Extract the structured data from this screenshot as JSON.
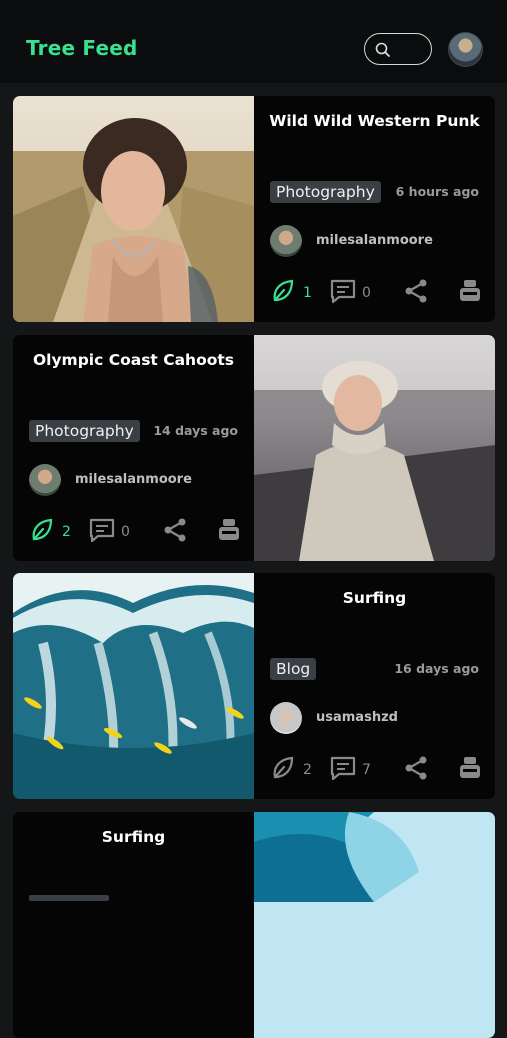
{
  "header": {
    "title": "Tree Feed",
    "search_icon": "search-icon",
    "avatar": "user-avatar"
  },
  "colors": {
    "accent": "#38e08f",
    "background": "#151618",
    "card": "#050506",
    "badge": "#3a3f46"
  },
  "posts": [
    {
      "title": "Wild Wild Western Punk",
      "category": "Photography",
      "time": "6 hours ago",
      "author": "milesalanmoore",
      "likes": "1",
      "comments": "0",
      "liked": true,
      "image": "portrait-woman-curly-hair"
    },
    {
      "title": "Olympic Coast Cahoots",
      "category": "Photography",
      "time": "14 days ago",
      "author": "milesalanmoore",
      "likes": "2",
      "comments": "0",
      "liked": true,
      "image": "woman-bucket-hat-beach"
    },
    {
      "title": "Surfing",
      "category": "Blog",
      "time": "16 days ago",
      "author": "usamashzd",
      "likes": "2",
      "comments": "7",
      "liked": false,
      "image": "surfers-on-wave"
    },
    {
      "title": "Surfing",
      "image": "wave-curl"
    }
  ]
}
